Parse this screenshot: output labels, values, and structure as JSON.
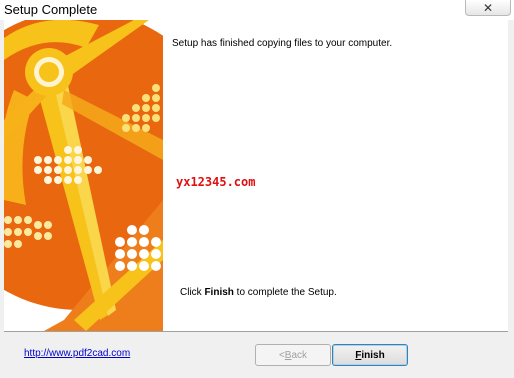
{
  "window": {
    "title": "Setup Complete",
    "close_glyph": "✕"
  },
  "content": {
    "message_top": "Setup has finished copying files to your computer.",
    "watermark": "yx12345.com",
    "message_bottom_prefix": "Click ",
    "message_bottom_bold": "Finish",
    "message_bottom_suffix": " to complete the Setup."
  },
  "footer": {
    "link_text": "http://www.pdf2cad.com",
    "back_label_prefix": "< ",
    "back_label_accel": "B",
    "back_label_rest": "ack",
    "finish_label_accel": "F",
    "finish_label_rest": "inish"
  },
  "colors": {
    "banner_orange": "#e8670f",
    "banner_yellow": "#f7c21a",
    "banner_light": "#fbe07a",
    "watermark": "#e01010",
    "link": "#0000cc"
  },
  "icons": {
    "close": "close-icon",
    "banner": "sun-beach-ball-graphic"
  }
}
